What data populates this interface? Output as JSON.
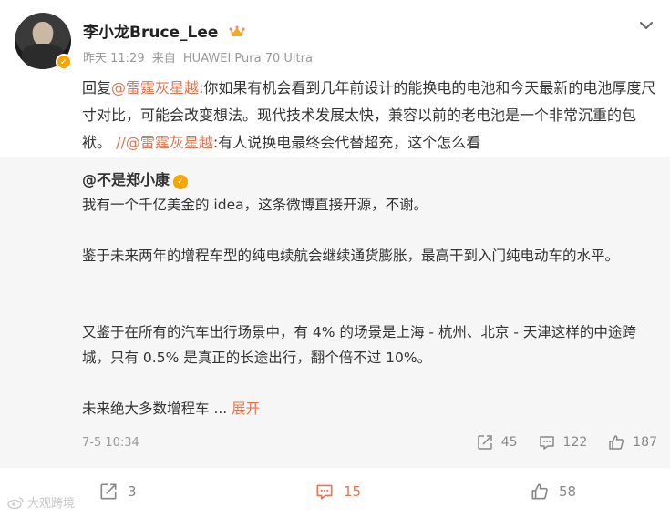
{
  "author": {
    "name": "李小龙Bruce_Lee",
    "time": "昨天 11:29",
    "source_prefix": "来自",
    "device": "HUAWEI Pura 70 Ultra"
  },
  "post": {
    "reply_prefix": "回复",
    "mention1": "@雷霆灰星越",
    "text1": ":你如果有机会看到几年前设计的能换电的电池和今天最新的电池厚度尺寸对比，可能会改变想法。现代技术发展太快，兼容以前的老电池是一个非常沉重的包袱。",
    "sep": "//",
    "mention2": "@雷霆灰星越",
    "text2": ":有人说换电最终会代替超充，这个怎么看"
  },
  "repost": {
    "author": "@不是郑小康",
    "para1": "我有一个千亿美金的 idea，这条微博直接开源，不谢。",
    "para2": "鉴于未来两年的增程车型的纯电续航会继续通货膨胀，最高干到入门纯电动车的水平。",
    "para3": "又鉴于在所有的汽车出行场景中，有 4% 的场景是上海 - 杭州、北京 - 天津这样的中途跨城，只有 0.5% 是真正的长途出行，翻个倍不过 10%。",
    "para4": "未来绝大多数增程车",
    "ellipsis": " ...",
    "expand": "展开",
    "time": "7-5 10:34",
    "reposts": "45",
    "comments": "122",
    "likes": "187"
  },
  "footer": {
    "reposts": "3",
    "comments": "15",
    "likes": "58",
    "watermark": "大观跨境"
  },
  "colors": {
    "accent": "#eb7350",
    "badge": "#f7a500",
    "repost_bg": "#f6f6f6"
  },
  "icons": [
    "verified-badge-icon",
    "crown-icon",
    "chevron-down-icon",
    "repost-icon",
    "comment-icon",
    "like-icon",
    "weibo-logo-icon"
  ]
}
